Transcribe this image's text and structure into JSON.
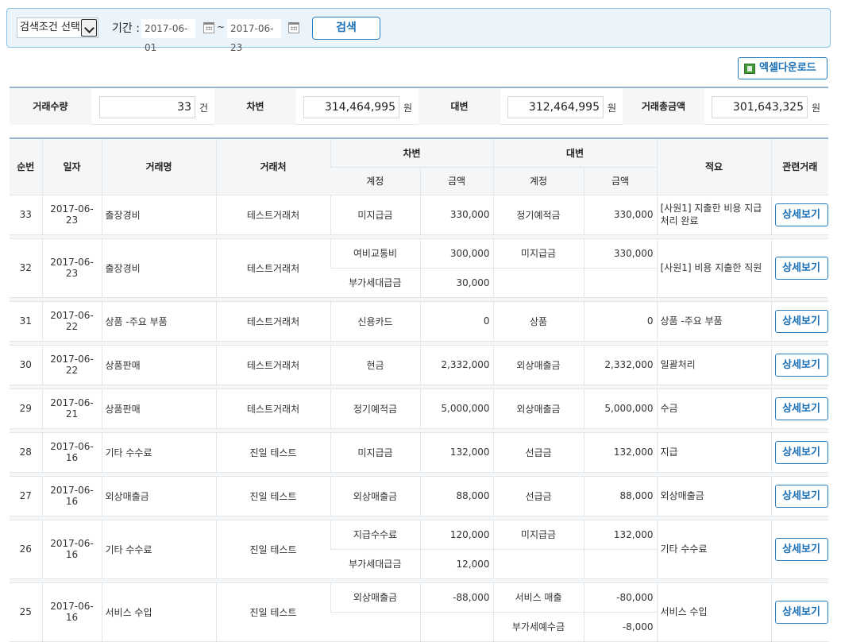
{
  "search": {
    "condition_label": "검색조건 선택",
    "period_label": "기간 :",
    "date_from": "2017-06-01",
    "date_sep": "~",
    "date_to": "2017-06-23",
    "search_button": "검색"
  },
  "excel_button": "엑셀다운로드",
  "summary": {
    "count_label": "거래수량",
    "count_value": "33",
    "count_unit": "건",
    "debit_label": "차변",
    "debit_value": "314,464,995",
    "debit_unit": "원",
    "credit_label": "대변",
    "credit_value": "312,464,995",
    "credit_unit": "원",
    "total_label": "거래총금액",
    "total_value": "301,643,325",
    "total_unit": "원"
  },
  "table": {
    "headers": {
      "no": "순번",
      "date": "일자",
      "name": "거래명",
      "partner": "거래처",
      "debit": "차변",
      "credit": "대변",
      "account": "계정",
      "amount": "금액",
      "memo": "적요",
      "related": "관련거래"
    },
    "detail_label": "상세보기",
    "rows": [
      {
        "no": "33",
        "date": "2017-06-23",
        "name": "출장경비",
        "partner": "테스트거래처",
        "lines": [
          {
            "d_acc": "미지급금",
            "d_amt": "330,000",
            "c_acc": "정기예적금",
            "c_amt": "330,000"
          }
        ],
        "memo": "[사원1] 지출한 비용 지급 처리 완료"
      },
      {
        "no": "32",
        "date": "2017-06-23",
        "name": "출장경비",
        "partner": "테스트거래처",
        "lines": [
          {
            "d_acc": "여비교통비",
            "d_amt": "300,000",
            "c_acc": "미지급금",
            "c_amt": "330,000"
          },
          {
            "d_acc": "부가세대급금",
            "d_amt": "30,000",
            "c_acc": "",
            "c_amt": ""
          }
        ],
        "memo": "[사원1] 비용 지출한 직원"
      },
      {
        "no": "31",
        "date": "2017-06-22",
        "name": "상품 -주요 부품",
        "partner": "테스트거래처",
        "lines": [
          {
            "d_acc": "신용카드",
            "d_amt": "0",
            "c_acc": "상품",
            "c_amt": "0"
          }
        ],
        "memo": "상품 -주요 부품"
      },
      {
        "no": "30",
        "date": "2017-06-22",
        "name": "상품판매",
        "partner": "테스트거래처",
        "lines": [
          {
            "d_acc": "현금",
            "d_amt": "2,332,000",
            "c_acc": "외상매출금",
            "c_amt": "2,332,000"
          }
        ],
        "memo": "일괄처리"
      },
      {
        "no": "29",
        "date": "2017-06-21",
        "name": "상품판매",
        "partner": "테스트거래처",
        "lines": [
          {
            "d_acc": "정기예적금",
            "d_amt": "5,000,000",
            "c_acc": "외상매출금",
            "c_amt": "5,000,000"
          }
        ],
        "memo": "수금"
      },
      {
        "no": "28",
        "date": "2017-06-16",
        "name": "기타 수수료",
        "partner": "진일 테스트",
        "lines": [
          {
            "d_acc": "미지급금",
            "d_amt": "132,000",
            "c_acc": "선급금",
            "c_amt": "132,000"
          }
        ],
        "memo": "지급"
      },
      {
        "no": "27",
        "date": "2017-06-16",
        "name": "외상매출금",
        "partner": "진일 테스트",
        "lines": [
          {
            "d_acc": "외상매출금",
            "d_amt": "88,000",
            "c_acc": "선급금",
            "c_amt": "88,000"
          }
        ],
        "memo": "외상매출금"
      },
      {
        "no": "26",
        "date": "2017-06-16",
        "name": "기타 수수료",
        "partner": "진일 테스트",
        "lines": [
          {
            "d_acc": "지급수수료",
            "d_amt": "120,000",
            "c_acc": "미지급금",
            "c_amt": "132,000"
          },
          {
            "d_acc": "부가세대급금",
            "d_amt": "12,000",
            "c_acc": "",
            "c_amt": ""
          }
        ],
        "memo": "기타 수수료"
      },
      {
        "no": "25",
        "date": "2017-06-16",
        "name": "서비스 수입",
        "partner": "진일 테스트",
        "lines": [
          {
            "d_acc": "외상매출금",
            "d_amt": "-88,000",
            "c_acc": "서비스 매출",
            "c_amt": "-80,000"
          },
          {
            "d_acc": "",
            "d_amt": "",
            "c_acc": "부가세예수금",
            "c_amt": "-8,000"
          }
        ],
        "memo": "서비스 수입"
      }
    ]
  },
  "colors": {
    "accent": "#2a7fc2",
    "search_bg": "#ebf4fb",
    "header_bg": "#f5f6f7",
    "header_border": "#99b3cc"
  }
}
